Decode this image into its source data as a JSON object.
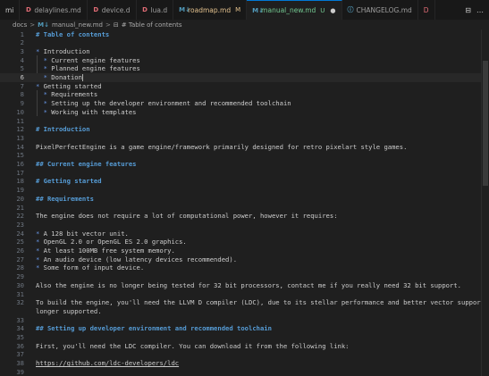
{
  "tabs": [
    {
      "label": "mi",
      "icon": "",
      "color": "#cccccc",
      "badge": "",
      "active": false,
      "icon_name": "partial-tab"
    },
    {
      "label": "delaylines.md",
      "icon": "D",
      "color": "#e06c75",
      "badge": "",
      "active": false,
      "icon_name": "d-language-icon"
    },
    {
      "label": "device.d",
      "icon": "D",
      "color": "#e06c75",
      "badge": "",
      "active": false,
      "icon_name": "d-language-icon"
    },
    {
      "label": "lua.d",
      "icon": "D",
      "color": "#e06c75",
      "badge": "",
      "active": false,
      "icon_name": "d-language-icon"
    },
    {
      "label": "roadmap.md",
      "icon": "M↓",
      "color": "#519aba",
      "badge": "M",
      "active": false,
      "icon_name": "markdown-icon"
    },
    {
      "label": "manual_new.md",
      "icon": "M↓",
      "color": "#519aba",
      "badge": "U",
      "active": true,
      "icon_name": "markdown-icon"
    },
    {
      "label": "CHANGELOG.md",
      "icon": "ⓘ",
      "color": "#519aba",
      "badge": "",
      "active": false,
      "icon_name": "info-icon"
    },
    {
      "label": "D",
      "icon": "",
      "color": "#e06c75",
      "badge": "",
      "active": false,
      "icon_name": "partial-tab"
    }
  ],
  "tab_actions": {
    "split": "⊟",
    "more": "…"
  },
  "breadcrumb": {
    "folder": "docs",
    "sep1": ">",
    "file_icon": "M↓",
    "file": "manual_new.md",
    "sep2": ">",
    "symbol_icon": "⊟",
    "symbol": "# Table of contents"
  },
  "editor": {
    "current_line": 6,
    "lines": [
      {
        "n": "1",
        "text": "# Table of contents",
        "kind": "heading"
      },
      {
        "n": "2",
        "text": "",
        "kind": "plain"
      },
      {
        "n": "3",
        "text": "* Introduction",
        "kind": "bullet"
      },
      {
        "n": "4",
        "text": "  * Current engine features",
        "kind": "bullet"
      },
      {
        "n": "5",
        "text": "  * Planned engine features",
        "kind": "bullet"
      },
      {
        "n": "6",
        "text": "  * Donation",
        "kind": "bullet"
      },
      {
        "n": "7",
        "text": "* Getting started",
        "kind": "bullet"
      },
      {
        "n": "8",
        "text": "  * Requirements",
        "kind": "bullet"
      },
      {
        "n": "9",
        "text": "  * Setting up the developer environment and recommended toolchain",
        "kind": "bullet"
      },
      {
        "n": "10",
        "text": "  * Working with templates",
        "kind": "bullet"
      },
      {
        "n": "11",
        "text": "",
        "kind": "plain"
      },
      {
        "n": "12",
        "text": "# Introduction",
        "kind": "heading"
      },
      {
        "n": "13",
        "text": "",
        "kind": "plain"
      },
      {
        "n": "14",
        "text": "PixelPerfectEngine is a game engine/framework primarily designed for retro pixelart style games.",
        "kind": "plain"
      },
      {
        "n": "15",
        "text": "",
        "kind": "plain"
      },
      {
        "n": "16",
        "text": "## Current engine features",
        "kind": "heading"
      },
      {
        "n": "17",
        "text": "",
        "kind": "plain"
      },
      {
        "n": "18",
        "text": "# Getting started",
        "kind": "heading"
      },
      {
        "n": "19",
        "text": "",
        "kind": "plain"
      },
      {
        "n": "20",
        "text": "## Requirements",
        "kind": "heading"
      },
      {
        "n": "21",
        "text": "",
        "kind": "plain"
      },
      {
        "n": "22",
        "text": "The engine does not require a lot of computational power, however it requires:",
        "kind": "plain"
      },
      {
        "n": "23",
        "text": "",
        "kind": "plain"
      },
      {
        "n": "24",
        "text": "* A 128 bit vector unit.",
        "kind": "bullet"
      },
      {
        "n": "25",
        "text": "* OpenGL 2.0 or OpenGL ES 2.0 graphics.",
        "kind": "bullet"
      },
      {
        "n": "26",
        "text": "* At least 100MB free system memory.",
        "kind": "bullet"
      },
      {
        "n": "27",
        "text": "* An audio device (low latency devices recommended).",
        "kind": "bullet"
      },
      {
        "n": "28",
        "text": "* Some form of input device.",
        "kind": "bullet"
      },
      {
        "n": "29",
        "text": "",
        "kind": "plain"
      },
      {
        "n": "30",
        "text": "Also the engine is no longer being tested for 32 bit processors, contact me if you really need 32 bit support.",
        "kind": "plain"
      },
      {
        "n": "31",
        "text": "",
        "kind": "plain"
      },
      {
        "n": "32",
        "text": "To build the engine, you'll need the LLVM D compiler (LDC), due to its stellar performance and better vector support. DMD no",
        "kind": "plain"
      },
      {
        "n": "",
        "text": "longer supported.",
        "kind": "plain"
      },
      {
        "n": "33",
        "text": "",
        "kind": "plain"
      },
      {
        "n": "34",
        "text": "## Setting up developer environment and recommended toolchain",
        "kind": "heading"
      },
      {
        "n": "35",
        "text": "",
        "kind": "plain"
      },
      {
        "n": "36",
        "text": "First, you'll need the LDC compiler. You can download it from the following link:",
        "kind": "plain"
      },
      {
        "n": "37",
        "text": "",
        "kind": "plain"
      },
      {
        "n": "38",
        "text": "https://github.com/ldc-developers/ldc",
        "kind": "link"
      },
      {
        "n": "39",
        "text": "",
        "kind": "plain"
      }
    ]
  },
  "colors": {
    "background": "#1f1f1f",
    "heading": "#569cd6",
    "bullet": "#6796e6",
    "modified": "#e2c08d",
    "untracked": "#73c991",
    "accent": "#0078d4"
  }
}
